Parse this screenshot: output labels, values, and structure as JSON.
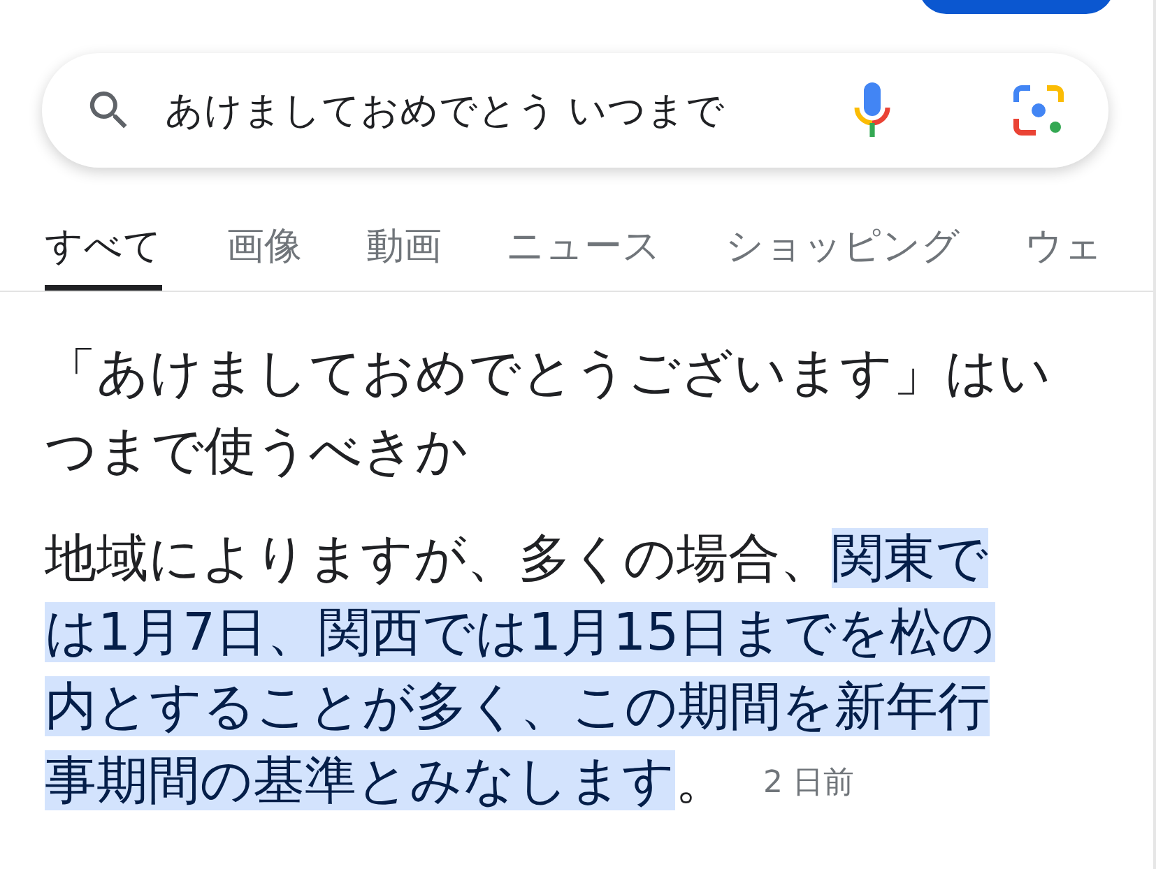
{
  "search": {
    "value": "あけましておめでとう いつまで"
  },
  "tabs": [
    {
      "label": "すべて",
      "selected": true
    },
    {
      "label": "画像",
      "selected": false
    },
    {
      "label": "動画",
      "selected": false
    },
    {
      "label": "ニュース",
      "selected": false
    },
    {
      "label": "ショッピング",
      "selected": false
    },
    {
      "label": "ウェ",
      "selected": false
    }
  ],
  "answer": {
    "title": "「あけましておめでとうございます」はいつまで使うべきか",
    "text_before": "地域によりますが、多くの場合、",
    "highlighted": "関東では1月7日、関西では1月15日までを松の内とすることが多く、この期間を新年行事期間の基準とみなします",
    "text_after": "。",
    "date": "2 日前"
  }
}
